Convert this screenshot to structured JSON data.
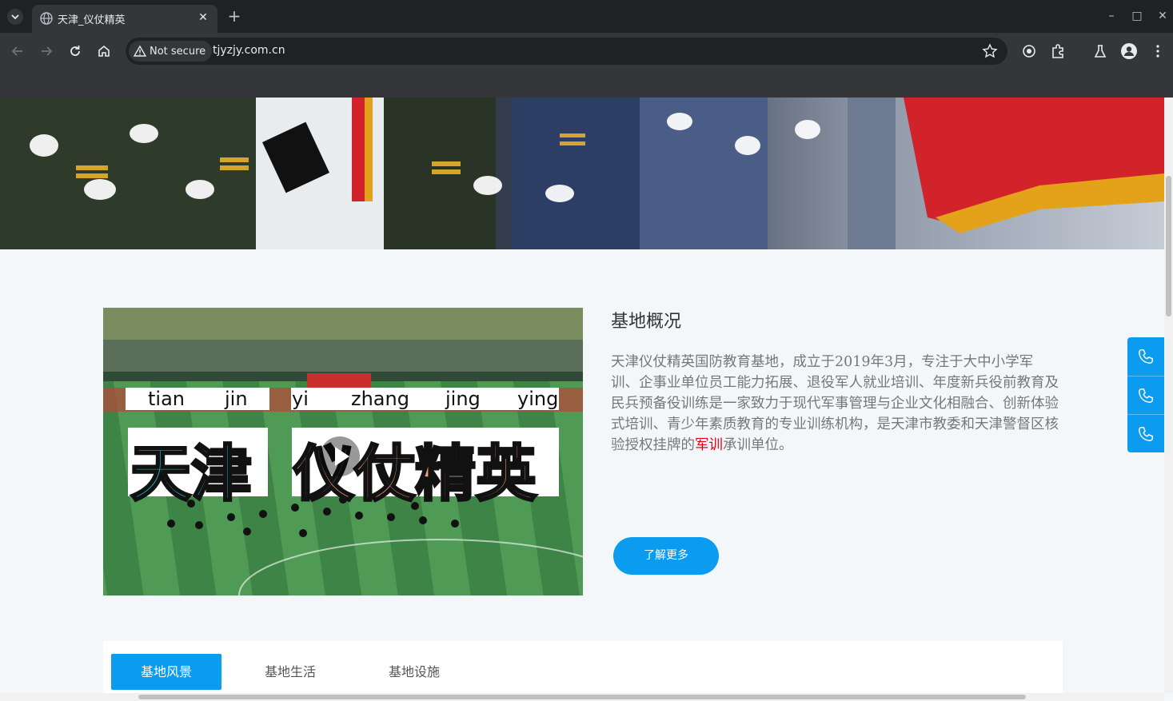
{
  "browser": {
    "tab_title": "天津_仪仗精英",
    "tab_close": "✕",
    "new_tab": "+",
    "security_label": "Not secure",
    "url": "tjyzjy.com.cn",
    "window_controls": {
      "minimize": "–",
      "maximize": "□",
      "close": "✕"
    }
  },
  "video": {
    "pinyin": [
      "tian",
      "jin",
      "yi",
      "zhang",
      "jing",
      "ying"
    ],
    "caption_cyan": "天津",
    "caption_orange": "仪仗精英"
  },
  "about": {
    "title": "基地概况",
    "text_before": "天津仪仗精英国防教育基地，成立于2019年3月，专注于大中小学军训、企事业单位员工能力拓展、退役军人就业培训、年度新兵役前教育及民兵预备役训练是一家致力于现代军事管理与企业文化相融合、创新体验式培训、青少年素质教育的专业训练机构，是天津市教委和天津警督区核验授权挂牌的",
    "text_highlight": "军训",
    "text_after": "承训单位。",
    "more_button": "了解更多"
  },
  "tabs": [
    {
      "label": "基地风景",
      "active": true
    },
    {
      "label": "基地生活",
      "active": false
    },
    {
      "label": "基地设施",
      "active": false
    }
  ],
  "side_contact": {
    "icons": [
      "phone-icon",
      "phone-icon",
      "phone-icon"
    ]
  },
  "colors": {
    "accent": "#0b9cf0",
    "highlight": "#e60012",
    "browser_dark": "#202124"
  }
}
